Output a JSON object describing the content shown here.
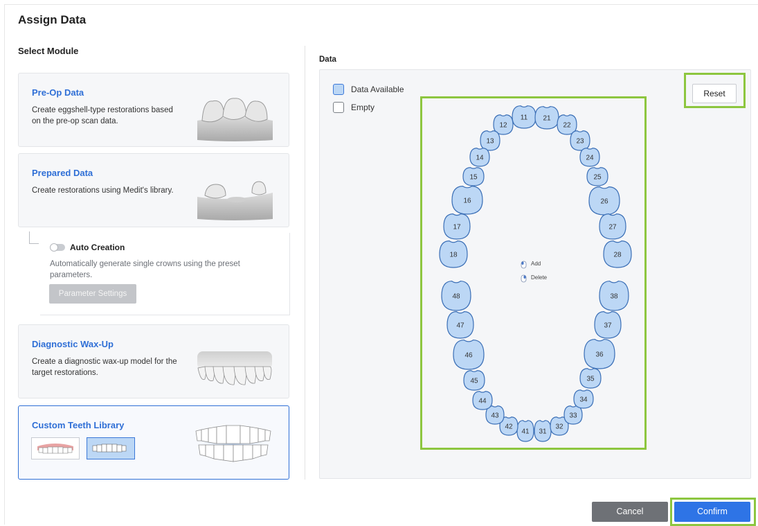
{
  "dialog": {
    "title": "Assign Data"
  },
  "left": {
    "section_title": "Select Module",
    "modules": [
      {
        "title": "Pre-Op Data",
        "desc": "Create eggshell-type restorations based on the pre-op scan data."
      },
      {
        "title": "Prepared Data",
        "desc": "Create restorations using Medit's library."
      },
      {
        "title": "Diagnostic Wax-Up",
        "desc": "Create a diagnostic wax-up model for the target restorations."
      },
      {
        "title": "Custom Teeth Library",
        "desc": ""
      }
    ],
    "auto_creation": {
      "label": "Auto Creation",
      "enabled": false,
      "desc": "Automatically generate single crowns using the preset parameters.",
      "param_button": "Parameter Settings"
    }
  },
  "right": {
    "section_title": "Data",
    "legend": {
      "available": "Data Available",
      "empty": "Empty"
    },
    "reset_label": "Reset",
    "mouse_hints": {
      "add": "Add",
      "delete": "Delete"
    },
    "teeth": [
      "11",
      "12",
      "13",
      "14",
      "15",
      "16",
      "17",
      "18",
      "21",
      "22",
      "23",
      "24",
      "25",
      "26",
      "27",
      "28",
      "31",
      "32",
      "33",
      "34",
      "35",
      "36",
      "37",
      "38",
      "41",
      "42",
      "43",
      "44",
      "45",
      "46",
      "47",
      "48"
    ]
  },
  "footer": {
    "cancel_label": "Cancel",
    "confirm_label": "Confirm"
  },
  "colors": {
    "accent": "#2e74e6",
    "highlight": "#8dc63f",
    "tooth_fill": "#bcd7f5",
    "tooth_stroke": "#3b6fb6"
  }
}
